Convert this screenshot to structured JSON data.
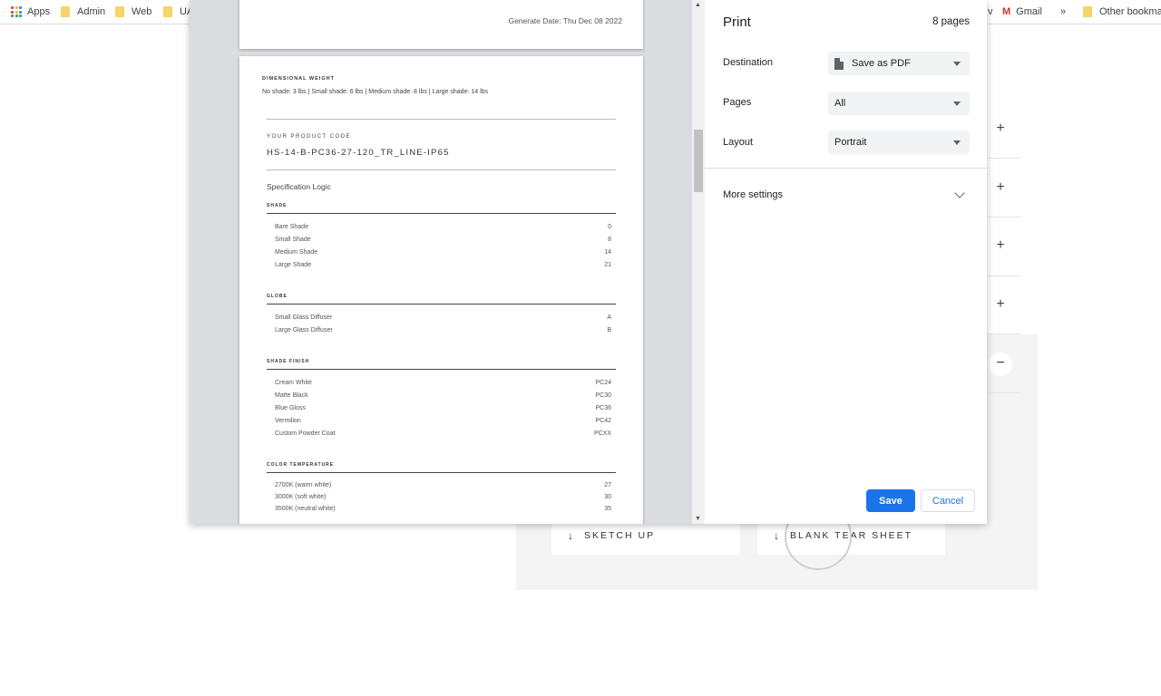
{
  "bookmarks": {
    "apps": "Apps",
    "items": [
      "Admin",
      "Web",
      "UA"
    ],
    "right_partial": "v",
    "gmail": "Gmail",
    "overflow": "»",
    "other": "Other bookmarks"
  },
  "background": {
    "accordion_icons": [
      "+",
      "+",
      "+",
      "+",
      "−"
    ],
    "downloads": [
      "SKETCH UP",
      "BLANK TEAR SHEET"
    ],
    "download_icon": "arrow-down-icon"
  },
  "preview": {
    "page1": {
      "generate_date": "Generate Date: Thu Dec 08 2022"
    },
    "page2": {
      "dim_title": "DIMENSIONAL WEIGHT",
      "dim_text": "No shade: 3 lbs | Small shade: 6 lbs | Medium shade: 8 lbs | Large shade: 14 lbs",
      "code_label": "YOUR PRODUCT CODE",
      "code_value": "HS-14-B-PC36-27-120_TR_LINE-IP65",
      "spec_logic": "Specification Logic",
      "sections": [
        {
          "title": "SHADE",
          "rows": [
            {
              "label": "Bare Shade",
              "value": "0"
            },
            {
              "label": "Small Shade",
              "value": "8"
            },
            {
              "label": "Medium Shade",
              "value": "14"
            },
            {
              "label": "Large Shade",
              "value": "21"
            }
          ]
        },
        {
          "title": "GLOBE",
          "rows": [
            {
              "label": "Small Glass Diffuser",
              "value": "A"
            },
            {
              "label": "Large Glass Diffuser",
              "value": "B"
            }
          ]
        },
        {
          "title": "SHADE FINISH",
          "rows": [
            {
              "label": "Cream White",
              "value": "PC24"
            },
            {
              "label": "Matte Black",
              "value": "PC30"
            },
            {
              "label": "Blue Gloss",
              "value": "PC36"
            },
            {
              "label": "Vermilion",
              "value": "PC42"
            },
            {
              "label": "Custom Powder Coat",
              "value": "PCXX"
            }
          ]
        },
        {
          "title": "COLOR TEMPERATURE",
          "rows": [
            {
              "label": "2700K (warm white)",
              "value": "27"
            },
            {
              "label": "3000K (soft white)",
              "value": "30"
            },
            {
              "label": "3500K (neutral white)",
              "value": "35"
            }
          ]
        }
      ]
    }
  },
  "print": {
    "title": "Print",
    "page_count": "8 pages",
    "destination": {
      "label": "Destination",
      "value": "Save as PDF"
    },
    "pages": {
      "label": "Pages",
      "value": "All"
    },
    "layout": {
      "label": "Layout",
      "value": "Portrait"
    },
    "more_settings": "More settings",
    "save_label": "Save",
    "cancel_label": "Cancel",
    "accent_color": "#1a73e8"
  }
}
